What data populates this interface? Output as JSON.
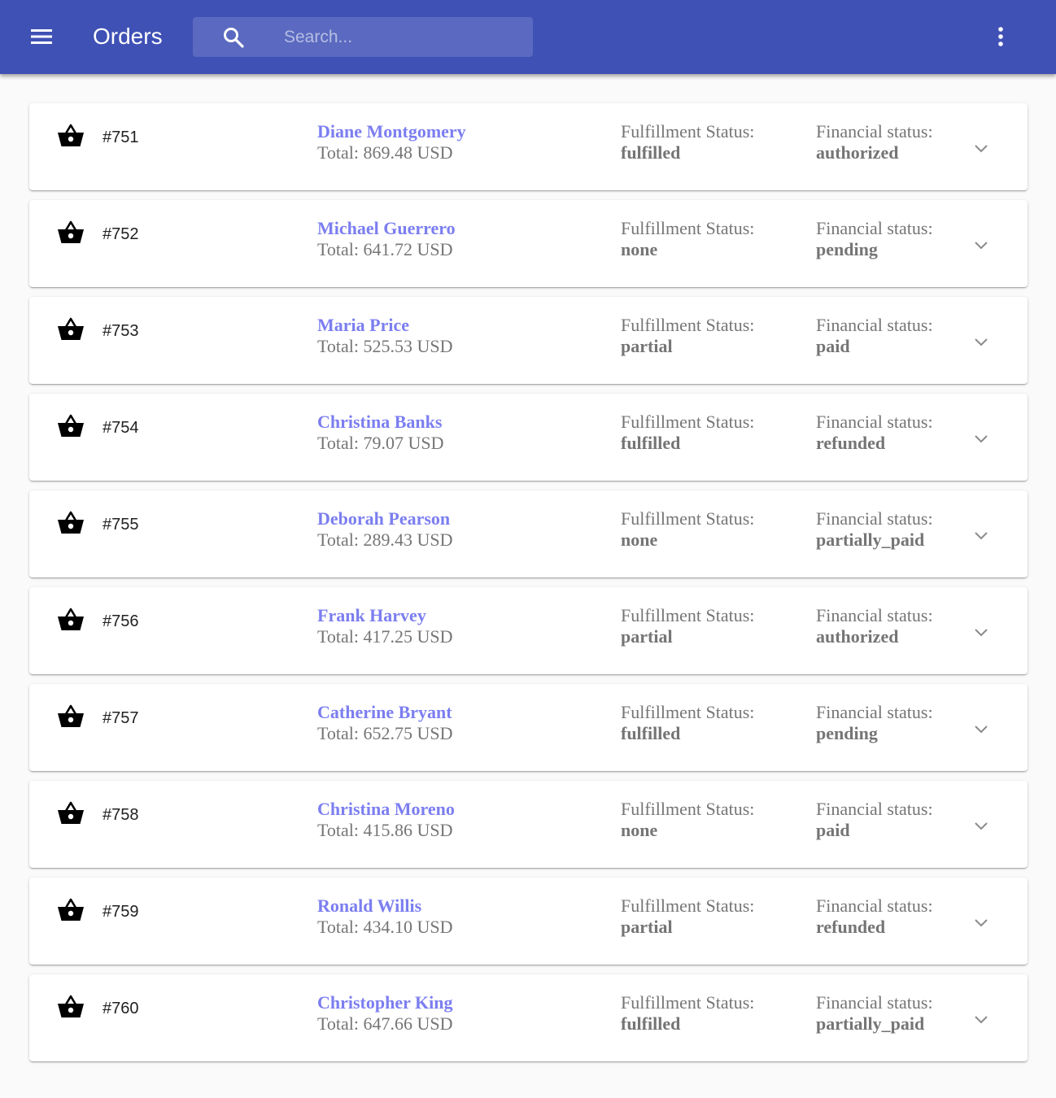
{
  "appbar": {
    "title": "Orders",
    "background_color": "#3f51b5",
    "menu_icon": "hamburger-menu-icon",
    "more_icon": "more-vertical-icon"
  },
  "search": {
    "placeholder": "Search...",
    "value": "",
    "icon": "search-icon"
  },
  "labels": {
    "total_prefix": "Total:",
    "fulfillment_label": "Fulfillment Status:",
    "financial_label": "Financial status:"
  },
  "colors": {
    "customer_link": "#7b7ef0",
    "muted_text": "#757575"
  },
  "orders": [
    {
      "number": "#751",
      "customer": "Diane Montgomery",
      "total": "Total: 869.48 USD",
      "fulfillment": "fulfilled",
      "financial": "authorized"
    },
    {
      "number": "#752",
      "customer": "Michael Guerrero",
      "total": "Total: 641.72 USD",
      "fulfillment": "none",
      "financial": "pending"
    },
    {
      "number": "#753",
      "customer": "Maria Price",
      "total": "Total: 525.53 USD",
      "fulfillment": "partial",
      "financial": "paid"
    },
    {
      "number": "#754",
      "customer": "Christina Banks",
      "total": "Total: 79.07 USD",
      "fulfillment": "fulfilled",
      "financial": "refunded"
    },
    {
      "number": "#755",
      "customer": "Deborah Pearson",
      "total": "Total: 289.43 USD",
      "fulfillment": "none",
      "financial": "partially_paid"
    },
    {
      "number": "#756",
      "customer": "Frank Harvey",
      "total": "Total: 417.25 USD",
      "fulfillment": "partial",
      "financial": "authorized"
    },
    {
      "number": "#757",
      "customer": "Catherine Bryant",
      "total": "Total: 652.75 USD",
      "fulfillment": "fulfilled",
      "financial": "pending"
    },
    {
      "number": "#758",
      "customer": "Christina Moreno",
      "total": "Total: 415.86 USD",
      "fulfillment": "none",
      "financial": "paid"
    },
    {
      "number": "#759",
      "customer": "Ronald Willis",
      "total": "Total: 434.10 USD",
      "fulfillment": "partial",
      "financial": "refunded"
    },
    {
      "number": "#760",
      "customer": "Christopher King",
      "total": "Total: 647.66 USD",
      "fulfillment": "fulfilled",
      "financial": "partially_paid"
    }
  ]
}
